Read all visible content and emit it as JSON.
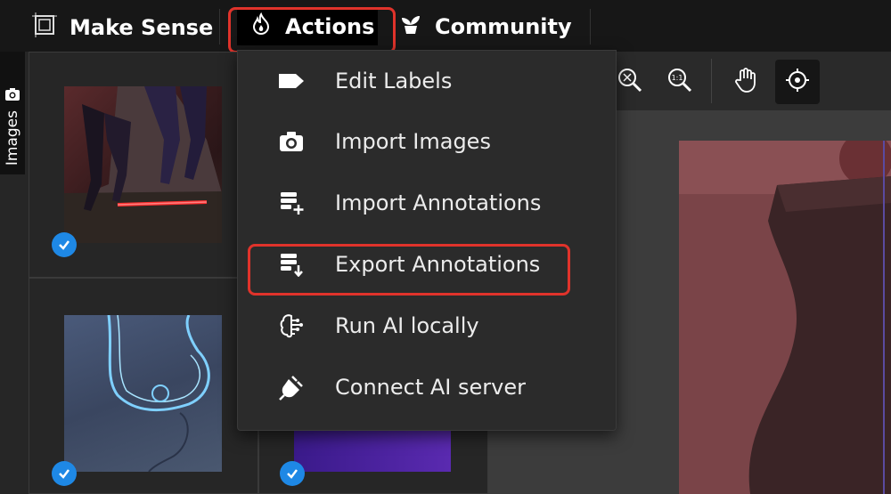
{
  "header": {
    "brand": "Make Sense",
    "nav": [
      {
        "label": "Actions",
        "icon": "fire-icon"
      },
      {
        "label": "Community",
        "icon": "plant-icon"
      }
    ]
  },
  "sidebar": {
    "tab_label": "Images"
  },
  "actions_menu": {
    "items": [
      {
        "label": "Edit Labels",
        "icon": "label-tag-icon"
      },
      {
        "label": "Import Images",
        "icon": "camera-icon"
      },
      {
        "label": "Import Annotations",
        "icon": "import-annotations-icon"
      },
      {
        "label": "Export Annotations",
        "icon": "export-annotations-icon"
      },
      {
        "label": "Run AI locally",
        "icon": "brain-icon"
      },
      {
        "label": "Connect AI server",
        "icon": "plug-icon"
      }
    ]
  },
  "toolbar": {
    "tools": [
      "zoom-fit-icon",
      "zoom-actual-icon",
      "hand-icon",
      "crosshair-icon"
    ],
    "zoom_actual_text": "1:1"
  },
  "highlight_color": "#e0332b",
  "check_color": "#1e88e5"
}
